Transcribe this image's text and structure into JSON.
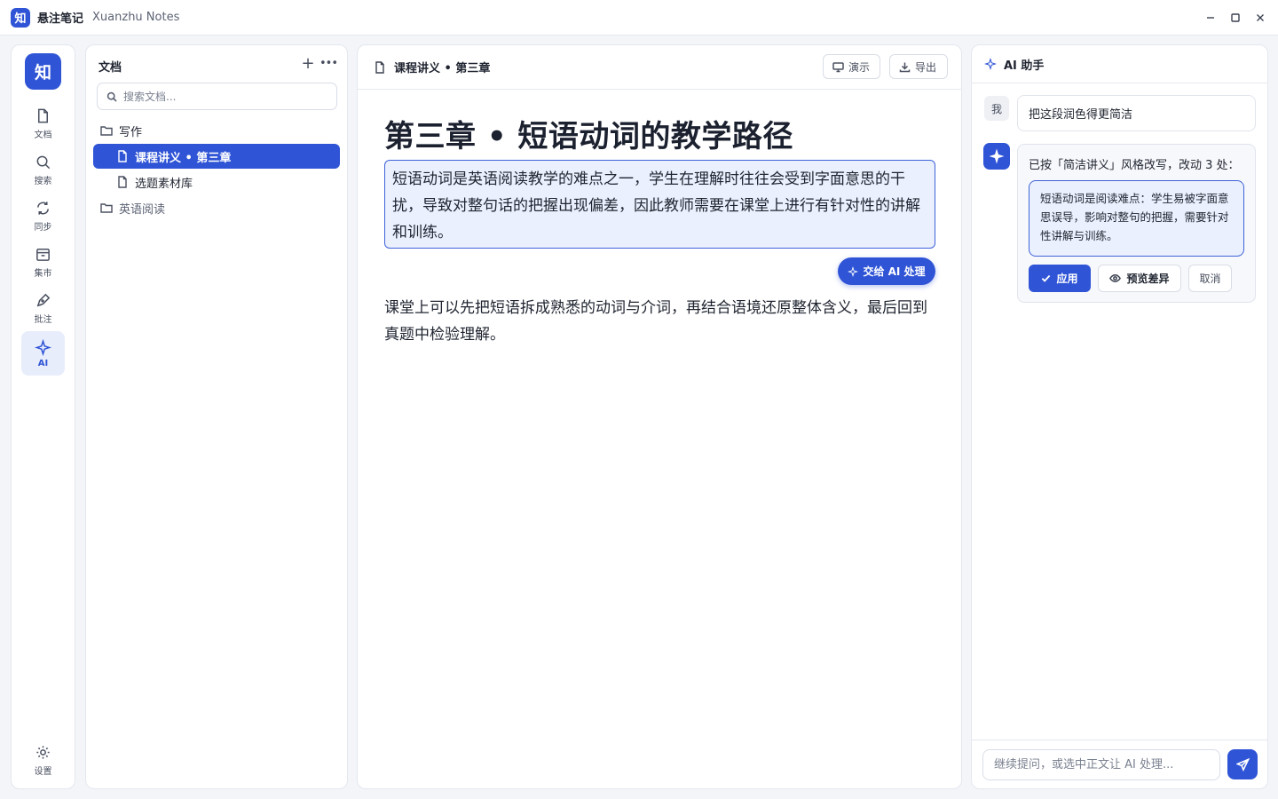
{
  "app": {
    "logo_char": "知",
    "title": "悬注笔记",
    "subtitle": "Xuanzhu Notes"
  },
  "rail": {
    "logo_char": "知",
    "items": [
      {
        "label": "文档",
        "icon": "file-icon"
      },
      {
        "label": "搜索",
        "icon": "search-icon"
      },
      {
        "label": "同步",
        "icon": "sync-icon"
      },
      {
        "label": "集市",
        "icon": "store-icon"
      },
      {
        "label": "批注",
        "icon": "pen-icon"
      },
      {
        "label": "AI",
        "icon": "sparkle-icon",
        "active": true
      }
    ],
    "settings_label": "设置"
  },
  "docs": {
    "heading": "文档",
    "add": "+",
    "more": "•••",
    "search_placeholder": "搜索文档...",
    "tree": [
      {
        "label": "写作",
        "type": "folder"
      },
      {
        "label": "课程讲义 • 第三章",
        "type": "file",
        "active": true
      },
      {
        "label": "选题素材库",
        "type": "file"
      },
      {
        "label": "英语阅读",
        "type": "folder"
      }
    ]
  },
  "editor": {
    "doc_title": "课程讲义 • 第三章",
    "present_label": "演示",
    "export_label": "导出",
    "heading": "第三章 • 短语动词的教学路径",
    "selected_paragraph": "短语动词是英语阅读教学的难点之一，学生在理解时往往会受到字面意思的干扰，导致对整句话的把握出现偏差，因此教师需要在课堂上进行有针对性的讲解和训练。",
    "ai_button": "交给 AI 处理",
    "paragraph": "课堂上可以先把短语拆成熟悉的动词与介词，再结合语境还原整体含义，最后回到真题中检验理解。"
  },
  "ai": {
    "title": "AI 助手",
    "me_avatar": "我",
    "user_message": "把这段润色得更简洁",
    "bot_intro": "已按「简洁讲义」风格改写，改动 3 处：",
    "bot_rewrite": "短语动词是阅读难点：学生易被字面意思误导，影响对整句的把握，需要针对性讲解与训练。",
    "apply_label": "应用",
    "diff_label": "预览差异",
    "cancel_label": "取消",
    "input_placeholder": "继续提问，或选中正文让 AI 处理..."
  },
  "colors": {
    "accent": "#2f54d6",
    "selection_bg": "#eaf0fd",
    "page_bg": "#f3f5f9"
  }
}
